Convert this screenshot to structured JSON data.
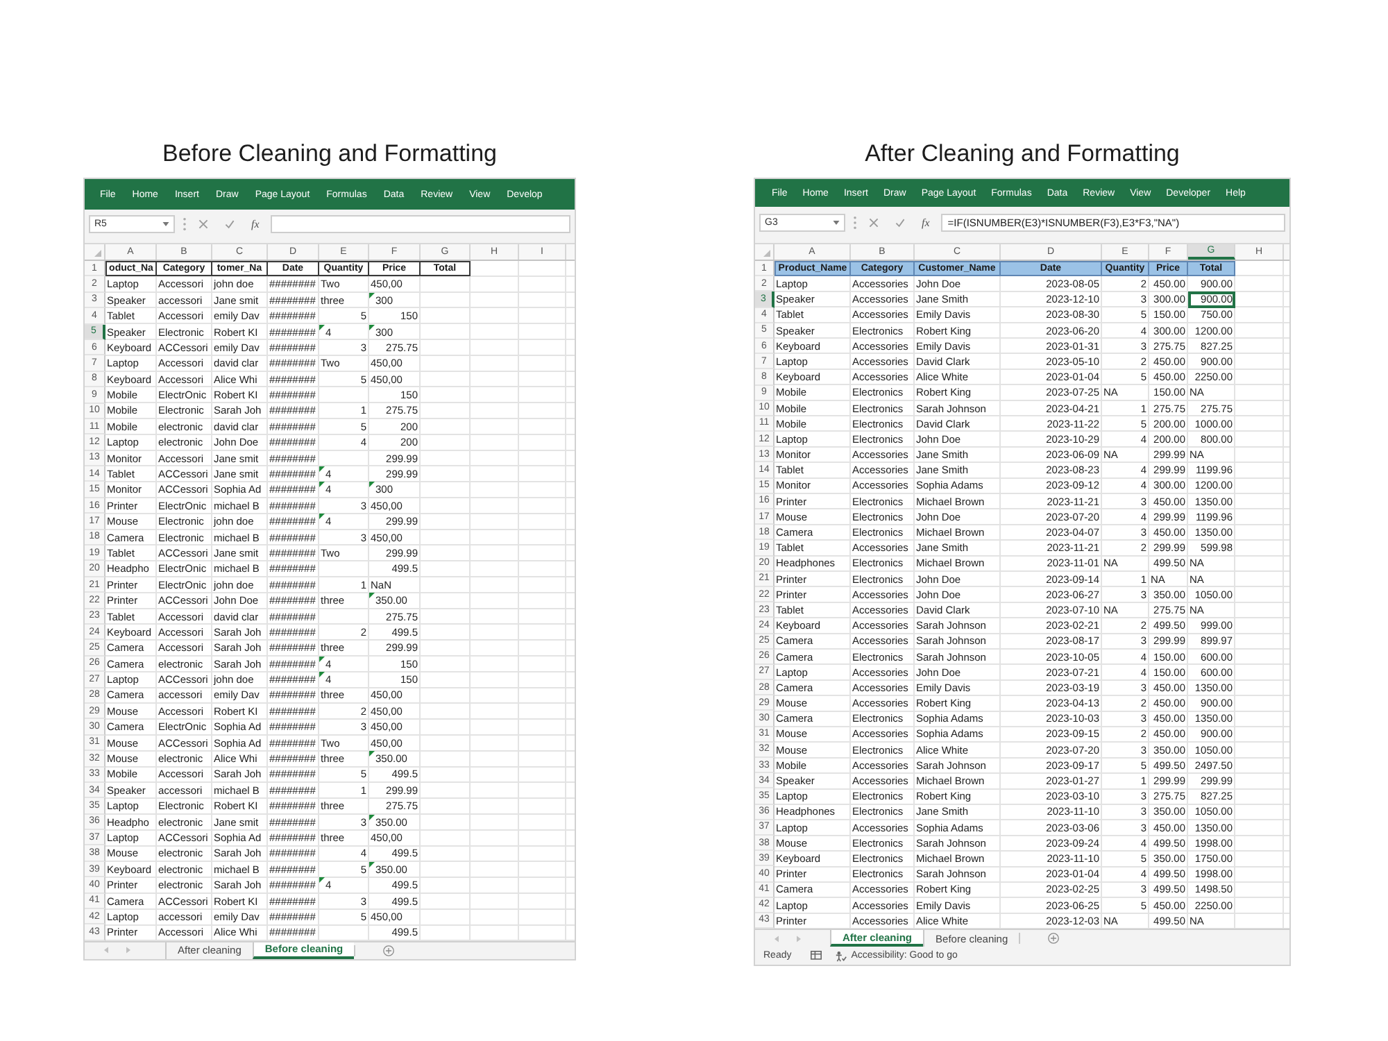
{
  "panels": [
    {
      "title": "Before Cleaning and Formatting",
      "ribbon": [
        "File",
        "Home",
        "Insert",
        "Draw",
        "Page Layout",
        "Formulas",
        "Data",
        "Review",
        "View",
        "Develop"
      ],
      "name_box": "R5",
      "function_label": "fx",
      "columns": [
        {
          "letter": "A",
          "selected": false,
          "kind": "text"
        },
        {
          "letter": "B",
          "selected": false,
          "kind": "text"
        },
        {
          "letter": "C",
          "selected": false,
          "kind": "text"
        },
        {
          "letter": "D",
          "selected": false,
          "kind": "text"
        },
        {
          "letter": "E",
          "selected": false,
          "kind": "text"
        },
        {
          "letter": "F",
          "selected": false,
          "kind": "text"
        },
        {
          "letter": "G",
          "selected": false
        },
        {
          "letter": "H",
          "selected": false
        },
        {
          "letter": "I",
          "selected": false
        }
      ],
      "header_row": {
        "number": "1",
        "selected": false,
        "kind": "bordered",
        "cells": [
          "oduct_Na",
          "Category",
          "tomer_Na",
          "Date",
          "Quantity",
          "Price",
          "Total"
        ]
      },
      "rows": [
        {
          "number": "2",
          "selected": false,
          "cells": [
            "Laptop",
            "Accessori",
            "john doe",
            "########",
            "Two",
            "450,00"
          ]
        },
        {
          "number": "3",
          "selected": false,
          "cells": [
            "Speaker",
            "accessori",
            "Jane smit",
            "########",
            "three",
            {
              "text": "300",
              "kind": "flagged"
            }
          ]
        },
        {
          "number": "4",
          "selected": false,
          "cells": [
            "Tablet",
            "Accessori",
            "emily Dav",
            "########",
            {
              "text": "5",
              "kind": "number"
            },
            {
              "text": "150",
              "kind": "number"
            }
          ]
        },
        {
          "number": "5",
          "selected": true,
          "cells": [
            "Speaker",
            "Electronic",
            "Robert KI",
            "########",
            {
              "text": "4",
              "kind": "flagged"
            },
            {
              "text": "300",
              "kind": "flagged"
            }
          ]
        },
        {
          "number": "6",
          "selected": false,
          "cells": [
            "Keyboard",
            "ACCessori",
            "emily Dav",
            "########",
            {
              "text": "3",
              "kind": "number"
            },
            {
              "text": "275.75",
              "kind": "number"
            }
          ]
        },
        {
          "number": "7",
          "selected": false,
          "cells": [
            "Laptop",
            "Accessori",
            "david clar",
            "########",
            "Two",
            "450,00"
          ]
        },
        {
          "number": "8",
          "selected": false,
          "cells": [
            "Keyboard",
            "Accessori",
            "Alice Whi",
            "########",
            {
              "text": "5",
              "kind": "number"
            },
            "450,00"
          ]
        },
        {
          "number": "9",
          "selected": false,
          "cells": [
            "Mobile",
            "ElectrOnic",
            "Robert KI",
            "########",
            null,
            {
              "text": "150",
              "kind": "number"
            }
          ]
        },
        {
          "number": "10",
          "selected": false,
          "cells": [
            "Mobile",
            "Electronic",
            "Sarah Joh",
            "########",
            {
              "text": "1",
              "kind": "number"
            },
            {
              "text": "275.75",
              "kind": "number"
            }
          ]
        },
        {
          "number": "11",
          "selected": false,
          "cells": [
            "Mobile",
            "electronic",
            "david clar",
            "########",
            {
              "text": "5",
              "kind": "number"
            },
            {
              "text": "200",
              "kind": "number"
            }
          ]
        },
        {
          "number": "12",
          "selected": false,
          "cells": [
            "Laptop",
            "electronic",
            "John Doe",
            "########",
            {
              "text": "4",
              "kind": "number"
            },
            {
              "text": "200",
              "kind": "number"
            }
          ]
        },
        {
          "number": "13",
          "selected": false,
          "cells": [
            "Monitor",
            "Accessori",
            "Jane smit",
            "########",
            null,
            {
              "text": "299.99",
              "kind": "number"
            }
          ]
        },
        {
          "number": "14",
          "selected": false,
          "cells": [
            "Tablet",
            "ACCessori",
            "Jane smit",
            "########",
            {
              "text": "4",
              "kind": "flagged"
            },
            {
              "text": "299.99",
              "kind": "number"
            }
          ]
        },
        {
          "number": "15",
          "selected": false,
          "cells": [
            "Monitor",
            "ACCessori",
            "Sophia Ad",
            "########",
            {
              "text": "4",
              "kind": "flagged"
            },
            {
              "text": "300",
              "kind": "flagged"
            }
          ]
        },
        {
          "number": "16",
          "selected": false,
          "cells": [
            "Printer",
            "ElectrOnic",
            "michael B",
            "########",
            {
              "text": "3",
              "kind": "number"
            },
            "450,00"
          ]
        },
        {
          "number": "17",
          "selected": false,
          "cells": [
            "Mouse",
            "Electronic",
            "john doe",
            "########",
            {
              "text": "4",
              "kind": "flagged"
            },
            {
              "text": "299.99",
              "kind": "number"
            }
          ]
        },
        {
          "number": "18",
          "selected": false,
          "cells": [
            "Camera",
            "Electronic",
            "michael B",
            "########",
            {
              "text": "3",
              "kind": "number"
            },
            "450,00"
          ]
        },
        {
          "number": "19",
          "selected": false,
          "cells": [
            "Tablet",
            "ACCessori",
            "Jane smit",
            "########",
            "Two",
            {
              "text": "299.99",
              "kind": "number"
            }
          ]
        },
        {
          "number": "20",
          "selected": false,
          "cells": [
            "Headpho",
            "ElectrOnic",
            "michael B",
            "########",
            null,
            {
              "text": "499.5",
              "kind": "number"
            }
          ]
        },
        {
          "number": "21",
          "selected": false,
          "cells": [
            "Printer",
            "ElectrOnic",
            "john doe",
            "########",
            {
              "text": "1",
              "kind": "number"
            },
            "NaN"
          ]
        },
        {
          "number": "22",
          "selected": false,
          "cells": [
            "Printer",
            "ACCessori",
            "John Doe",
            "########",
            "three",
            {
              "text": "350.00",
              "kind": "flagged"
            }
          ]
        },
        {
          "number": "23",
          "selected": false,
          "cells": [
            "Tablet",
            "Accessori",
            "david clar",
            "########",
            null,
            {
              "text": "275.75",
              "kind": "number"
            }
          ]
        },
        {
          "number": "24",
          "selected": false,
          "cells": [
            "Keyboard",
            "Accessori",
            "Sarah Joh",
            "########",
            {
              "text": "2",
              "kind": "number"
            },
            {
              "text": "499.5",
              "kind": "number"
            }
          ]
        },
        {
          "number": "25",
          "selected": false,
          "cells": [
            "Camera",
            "Accessori",
            "Sarah Joh",
            "########",
            "three",
            {
              "text": "299.99",
              "kind": "number"
            }
          ]
        },
        {
          "number": "26",
          "selected": false,
          "cells": [
            "Camera",
            "electronic",
            "Sarah Joh",
            "########",
            {
              "text": "4",
              "kind": "flagged"
            },
            {
              "text": "150",
              "kind": "number"
            }
          ]
        },
        {
          "number": "27",
          "selected": false,
          "cells": [
            "Laptop",
            "ACCessori",
            "john doe",
            "########",
            {
              "text": "4",
              "kind": "flagged"
            },
            {
              "text": "150",
              "kind": "number"
            }
          ]
        },
        {
          "number": "28",
          "selected": false,
          "cells": [
            "Camera",
            "accessori",
            "emily Dav",
            "########",
            "three",
            "450,00"
          ]
        },
        {
          "number": "29",
          "selected": false,
          "cells": [
            "Mouse",
            "Accessori",
            "Robert KI",
            "########",
            {
              "text": "2",
              "kind": "number"
            },
            "450,00"
          ]
        },
        {
          "number": "30",
          "selected": false,
          "cells": [
            "Camera",
            "ElectrOnic",
            "Sophia Ad",
            "########",
            {
              "text": "3",
              "kind": "number"
            },
            "450,00"
          ]
        },
        {
          "number": "31",
          "selected": false,
          "cells": [
            "Mouse",
            "ACCessori",
            "Sophia Ad",
            "########",
            "Two",
            "450,00"
          ]
        },
        {
          "number": "32",
          "selected": false,
          "cells": [
            "Mouse",
            "electronic",
            "Alice Whi",
            "########",
            "three",
            {
              "text": "350.00",
              "kind": "flagged"
            }
          ]
        },
        {
          "number": "33",
          "selected": false,
          "cells": [
            "Mobile",
            "Accessori",
            "Sarah Joh",
            "########",
            {
              "text": "5",
              "kind": "number"
            },
            {
              "text": "499.5",
              "kind": "number"
            }
          ]
        },
        {
          "number": "34",
          "selected": false,
          "cells": [
            "Speaker",
            "accessori",
            "michael B",
            "########",
            {
              "text": "1",
              "kind": "number"
            },
            {
              "text": "299.99",
              "kind": "number"
            }
          ]
        },
        {
          "number": "35",
          "selected": false,
          "cells": [
            "Laptop",
            "Electronic",
            "Robert KI",
            "########",
            "three",
            {
              "text": "275.75",
              "kind": "number"
            }
          ]
        },
        {
          "number": "36",
          "selected": false,
          "cells": [
            "Headpho",
            "electronic",
            "Jane smit",
            "########",
            {
              "text": "3",
              "kind": "number"
            },
            {
              "text": "350.00",
              "kind": "flagged"
            }
          ]
        },
        {
          "number": "37",
          "selected": false,
          "cells": [
            "Laptop",
            "ACCessori",
            "Sophia Ad",
            "########",
            "three",
            "450,00"
          ]
        },
        {
          "number": "38",
          "selected": false,
          "cells": [
            "Mouse",
            "electronic",
            "Sarah Joh",
            "########",
            {
              "text": "4",
              "kind": "number"
            },
            {
              "text": "499.5",
              "kind": "number"
            }
          ]
        },
        {
          "number": "39",
          "selected": false,
          "cells": [
            "Keyboard",
            "electronic",
            "michael B",
            "########",
            {
              "text": "5",
              "kind": "number"
            },
            {
              "text": "350.00",
              "kind": "flagged"
            }
          ]
        },
        {
          "number": "40",
          "selected": false,
          "cells": [
            "Printer",
            "electronic",
            "Sarah Joh",
            "########",
            {
              "text": "4",
              "kind": "flagged"
            },
            {
              "text": "499.5",
              "kind": "number"
            }
          ]
        },
        {
          "number": "41",
          "selected": false,
          "cells": [
            "Camera",
            "ACCessori",
            "Robert KI",
            "########",
            {
              "text": "3",
              "kind": "number"
            },
            {
              "text": "499.5",
              "kind": "number"
            }
          ]
        },
        {
          "number": "42",
          "selected": false,
          "cells": [
            "Laptop",
            "accessori",
            "emily Dav",
            "########",
            {
              "text": "5",
              "kind": "number"
            },
            "450,00"
          ]
        },
        {
          "number": "43",
          "selected": false,
          "cells": [
            "Printer",
            "Accessori",
            "Alice Whi",
            "########",
            null,
            {
              "text": "499.5",
              "kind": "number"
            }
          ]
        }
      ],
      "sheets": [
        {
          "label": "After cleaning",
          "selected": false
        },
        {
          "label": "Before cleaning",
          "selected": true
        }
      ]
    },
    {
      "title": "After Cleaning and Formatting",
      "ribbon": [
        "File",
        "Home",
        "Insert",
        "Draw",
        "Page Layout",
        "Formulas",
        "Data",
        "Review",
        "View",
        "Developer",
        "Help"
      ],
      "name_box": "G3",
      "function_label": "fx",
      "formula": "=IF(ISNUMBER(E3)*ISNUMBER(F3),E3*F3,\"NA\")",
      "columns": [
        {
          "letter": "A",
          "selected": false,
          "kind": "text"
        },
        {
          "letter": "B",
          "selected": false,
          "kind": "text"
        },
        {
          "letter": "C",
          "selected": false,
          "kind": "text"
        },
        {
          "letter": "D",
          "selected": false,
          "kind": "number"
        },
        {
          "letter": "E",
          "selected": false,
          "kind": "number"
        },
        {
          "letter": "F",
          "selected": false,
          "kind": "number"
        },
        {
          "letter": "G",
          "selected": true,
          "kind": "number"
        },
        {
          "letter": "H",
          "selected": false
        }
      ],
      "header_row": {
        "number": "1",
        "selected": false,
        "kind": "filled",
        "cells": [
          "Product_Name",
          "Category",
          "Customer_Name",
          "Date",
          "Quantity",
          "Price",
          "Total"
        ]
      },
      "rows": [
        {
          "number": "2",
          "selected": false,
          "cells": [
            "Laptop",
            "Accessories",
            "John Doe",
            "2023-08-05",
            "2",
            "450.00",
            "900.00"
          ]
        },
        {
          "number": "3",
          "selected": true,
          "cells": [
            "Speaker",
            "Accessories",
            "Jane Smith",
            "2023-12-10",
            "3",
            "300.00",
            "900.00"
          ]
        },
        {
          "number": "4",
          "selected": false,
          "cells": [
            "Tablet",
            "Accessories",
            "Emily Davis",
            "2023-08-30",
            "5",
            "150.00",
            "750.00"
          ]
        },
        {
          "number": "5",
          "selected": false,
          "cells": [
            "Speaker",
            "Electronics",
            "Robert King",
            "2023-06-20",
            "4",
            "300.00",
            "1200.00"
          ]
        },
        {
          "number": "6",
          "selected": false,
          "cells": [
            "Keyboard",
            "Accessories",
            "Emily Davis",
            "2023-01-31",
            "3",
            "275.75",
            "827.25"
          ]
        },
        {
          "number": "7",
          "selected": false,
          "cells": [
            "Laptop",
            "Accessories",
            "David Clark",
            "2023-05-10",
            "2",
            "450.00",
            "900.00"
          ]
        },
        {
          "number": "8",
          "selected": false,
          "cells": [
            "Keyboard",
            "Accessories",
            "Alice White",
            "2023-01-04",
            "5",
            "450.00",
            "2250.00"
          ]
        },
        {
          "number": "9",
          "selected": false,
          "cells": [
            "Mobile",
            "Electronics",
            "Robert King",
            "2023-07-25",
            {
              "text": "NA",
              "kind": "text"
            },
            "150.00",
            {
              "text": "NA",
              "kind": "text"
            }
          ]
        },
        {
          "number": "10",
          "selected": false,
          "cells": [
            "Mobile",
            "Electronics",
            "Sarah Johnson",
            "2023-04-21",
            "1",
            "275.75",
            "275.75"
          ]
        },
        {
          "number": "11",
          "selected": false,
          "cells": [
            "Mobile",
            "Electronics",
            "David Clark",
            "2023-11-22",
            "5",
            "200.00",
            "1000.00"
          ]
        },
        {
          "number": "12",
          "selected": false,
          "cells": [
            "Laptop",
            "Electronics",
            "John Doe",
            "2023-10-29",
            "4",
            "200.00",
            "800.00"
          ]
        },
        {
          "number": "13",
          "selected": false,
          "cells": [
            "Monitor",
            "Accessories",
            "Jane Smith",
            "2023-06-09",
            {
              "text": "NA",
              "kind": "text"
            },
            "299.99",
            {
              "text": "NA",
              "kind": "text"
            }
          ]
        },
        {
          "number": "14",
          "selected": false,
          "cells": [
            "Tablet",
            "Accessories",
            "Jane Smith",
            "2023-08-23",
            "4",
            "299.99",
            "1199.96"
          ]
        },
        {
          "number": "15",
          "selected": false,
          "cells": [
            "Monitor",
            "Accessories",
            "Sophia Adams",
            "2023-09-12",
            "4",
            "300.00",
            "1200.00"
          ]
        },
        {
          "number": "16",
          "selected": false,
          "cells": [
            "Printer",
            "Electronics",
            "Michael Brown",
            "2023-11-21",
            "3",
            "450.00",
            "1350.00"
          ]
        },
        {
          "number": "17",
          "selected": false,
          "cells": [
            "Mouse",
            "Electronics",
            "John Doe",
            "2023-07-20",
            "4",
            "299.99",
            "1199.96"
          ]
        },
        {
          "number": "18",
          "selected": false,
          "cells": [
            "Camera",
            "Electronics",
            "Michael Brown",
            "2023-04-07",
            "3",
            "450.00",
            "1350.00"
          ]
        },
        {
          "number": "19",
          "selected": false,
          "cells": [
            "Tablet",
            "Accessories",
            "Jane Smith",
            "2023-11-21",
            "2",
            "299.99",
            "599.98"
          ]
        },
        {
          "number": "20",
          "selected": false,
          "cells": [
            "Headphones",
            "Electronics",
            "Michael Brown",
            "2023-11-01",
            {
              "text": "NA",
              "kind": "text"
            },
            "499.50",
            {
              "text": "NA",
              "kind": "text"
            }
          ]
        },
        {
          "number": "21",
          "selected": false,
          "cells": [
            "Printer",
            "Electronics",
            "John Doe",
            "2023-09-14",
            "1",
            {
              "text": "NA",
              "kind": "text"
            },
            {
              "text": "NA",
              "kind": "text"
            }
          ]
        },
        {
          "number": "22",
          "selected": false,
          "cells": [
            "Printer",
            "Accessories",
            "John Doe",
            "2023-06-27",
            "3",
            "350.00",
            "1050.00"
          ]
        },
        {
          "number": "23",
          "selected": false,
          "cells": [
            "Tablet",
            "Accessories",
            "David Clark",
            "2023-07-10",
            {
              "text": "NA",
              "kind": "text"
            },
            "275.75",
            {
              "text": "NA",
              "kind": "text"
            }
          ]
        },
        {
          "number": "24",
          "selected": false,
          "cells": [
            "Keyboard",
            "Accessories",
            "Sarah Johnson",
            "2023-02-21",
            "2",
            "499.50",
            "999.00"
          ]
        },
        {
          "number": "25",
          "selected": false,
          "cells": [
            "Camera",
            "Accessories",
            "Sarah Johnson",
            "2023-08-17",
            "3",
            "299.99",
            "899.97"
          ]
        },
        {
          "number": "26",
          "selected": false,
          "cells": [
            "Camera",
            "Electronics",
            "Sarah Johnson",
            "2023-10-05",
            "4",
            "150.00",
            "600.00"
          ]
        },
        {
          "number": "27",
          "selected": false,
          "cells": [
            "Laptop",
            "Accessories",
            "John Doe",
            "2023-07-21",
            "4",
            "150.00",
            "600.00"
          ]
        },
        {
          "number": "28",
          "selected": false,
          "cells": [
            "Camera",
            "Accessories",
            "Emily Davis",
            "2023-03-19",
            "3",
            "450.00",
            "1350.00"
          ]
        },
        {
          "number": "29",
          "selected": false,
          "cells": [
            "Mouse",
            "Accessories",
            "Robert King",
            "2023-04-13",
            "2",
            "450.00",
            "900.00"
          ]
        },
        {
          "number": "30",
          "selected": false,
          "cells": [
            "Camera",
            "Electronics",
            "Sophia Adams",
            "2023-10-03",
            "3",
            "450.00",
            "1350.00"
          ]
        },
        {
          "number": "31",
          "selected": false,
          "cells": [
            "Mouse",
            "Accessories",
            "Sophia Adams",
            "2023-09-15",
            "2",
            "450.00",
            "900.00"
          ]
        },
        {
          "number": "32",
          "selected": false,
          "cells": [
            "Mouse",
            "Electronics",
            "Alice White",
            "2023-07-20",
            "3",
            "350.00",
            "1050.00"
          ]
        },
        {
          "number": "33",
          "selected": false,
          "cells": [
            "Mobile",
            "Accessories",
            "Sarah Johnson",
            "2023-09-17",
            "5",
            "499.50",
            "2497.50"
          ]
        },
        {
          "number": "34",
          "selected": false,
          "cells": [
            "Speaker",
            "Accessories",
            "Michael Brown",
            "2023-01-27",
            "1",
            "299.99",
            "299.99"
          ]
        },
        {
          "number": "35",
          "selected": false,
          "cells": [
            "Laptop",
            "Electronics",
            "Robert King",
            "2023-03-10",
            "3",
            "275.75",
            "827.25"
          ]
        },
        {
          "number": "36",
          "selected": false,
          "cells": [
            "Headphones",
            "Electronics",
            "Jane Smith",
            "2023-11-10",
            "3",
            "350.00",
            "1050.00"
          ]
        },
        {
          "number": "37",
          "selected": false,
          "cells": [
            "Laptop",
            "Accessories",
            "Sophia Adams",
            "2023-03-06",
            "3",
            "450.00",
            "1350.00"
          ]
        },
        {
          "number": "38",
          "selected": false,
          "cells": [
            "Mouse",
            "Electronics",
            "Sarah Johnson",
            "2023-09-24",
            "4",
            "499.50",
            "1998.00"
          ]
        },
        {
          "number": "39",
          "selected": false,
          "cells": [
            "Keyboard",
            "Electronics",
            "Michael Brown",
            "2023-11-10",
            "5",
            "350.00",
            "1750.00"
          ]
        },
        {
          "number": "40",
          "selected": false,
          "cells": [
            "Printer",
            "Electronics",
            "Sarah Johnson",
            "2023-01-04",
            "4",
            "499.50",
            "1998.00"
          ]
        },
        {
          "number": "41",
          "selected": false,
          "cells": [
            "Camera",
            "Accessories",
            "Robert King",
            "2023-02-25",
            "3",
            "499.50",
            "1498.50"
          ]
        },
        {
          "number": "42",
          "selected": false,
          "cells": [
            "Laptop",
            "Accessories",
            "Emily Davis",
            "2023-06-25",
            "5",
            "450.00",
            "2250.00"
          ]
        },
        {
          "number": "43",
          "selected": false,
          "cells": [
            "Printer",
            "Accessories",
            "Alice White",
            "2023-12-03",
            {
              "text": "NA",
              "kind": "text"
            },
            "499.50",
            {
              "text": "NA",
              "kind": "text"
            }
          ]
        }
      ],
      "sheets": [
        {
          "label": "After cleaning",
          "selected": true
        },
        {
          "label": "Before cleaning",
          "selected": false
        }
      ],
      "status_bar": {
        "ready": "Ready",
        "accessibility": "Accessibility: Good to go"
      }
    }
  ]
}
